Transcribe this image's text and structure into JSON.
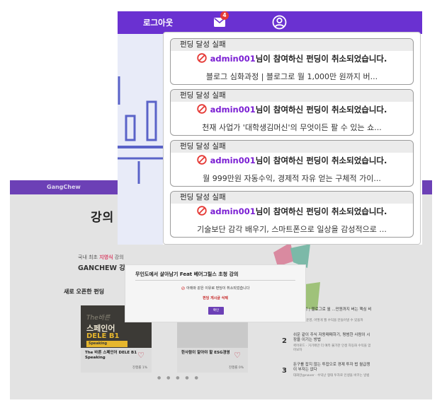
{
  "header": {
    "logout_label": "로그아웃",
    "mail_badge": "4",
    "mail_icon": "mail-icon",
    "user_icon": "user-circle-icon",
    "color": "#6a31d1"
  },
  "notifications": [
    {
      "title": "펀딩 달성 실패",
      "user": "admin001",
      "message": "님이 참여하신 펀딩이 취소되었습니다.",
      "course": "블로그 심화과정 | 블로그로 월 1,000만 원까지 버..."
    },
    {
      "title": "펀딩 달성 실패",
      "user": "admin001",
      "message": "님이 참여하신 펀딩이 취소되었습니다.",
      "course": "천재 사업가 '대학생김머신'의 무엇이든 팔 수 있는 쇼..."
    },
    {
      "title": "펀딩 달성 실패",
      "user": "admin001",
      "message": "님이 참여하신 펀딩이 취소되었습니다.",
      "course": "월 999만원 자동수익, 경제적 자유 얻는 구체적 가이..."
    },
    {
      "title": "펀딩 달성 실패",
      "user": "admin001",
      "message": "님이 참여하신 펀딩이 취소되었습니다.",
      "course": "기술보단 감각 배우기, 스마트폰으로 일상을 감성적으로 ..."
    }
  ],
  "background": {
    "brand": "GangChew",
    "heading": "강의",
    "promo_prefix": "국내 최초 ",
    "promo_highlight": "지영식",
    "promo_suffix": " 강의",
    "promo_big": "GANCHEW 강",
    "new_funding": "새로 오픈한 펀딩",
    "modal": {
      "title": "무인도에서 살아남기 Feat 베어그릴스 초청 강의",
      "message": "아래와 같은 이유로 펀딩이 취소되었습니다",
      "link": "펀딩 게시글 삭제",
      "ok": "확인"
    },
    "cards": [
      {
        "thumb_line1": "The바른",
        "thumb_line2": "스페인어",
        "thumb_line3": "DELE B1",
        "thumb_line4": "Speaking",
        "title": "The 바른 스페인어 DELE B1 Speaking",
        "rate": "진행률 1%"
      },
      {
        "title": "한사람이 알아야 할 ESG경영",
        "rate": "진행률 0%"
      }
    ],
    "ranking": [
      {
        "num": "1",
        "title": "심화과정 | 블로그로 월 ...만원까지 버는 핵심 비법!",
        "desc": "...블로그 운영, 어떻게 월 수익을 만들어낼 수 있을까"
      },
      {
        "num": "2",
        "title": "쉬운 같이 주식 자동매매하기, 평범한 사람이 시장을 이기는 방법",
        "desc": "퀵어로드 · 거기에만 더 예측 불가한 인생 자동화 수익을 얻어보자"
      },
      {
        "num": "3",
        "title": "돈구를 잡지 않는 투잡으로 경제 투자 법 월급쟁이 부자는 없다",
        "desc": "대화만@naver · 수익난 형태 투자로 인생을 바꾸는 방법"
      }
    ]
  }
}
